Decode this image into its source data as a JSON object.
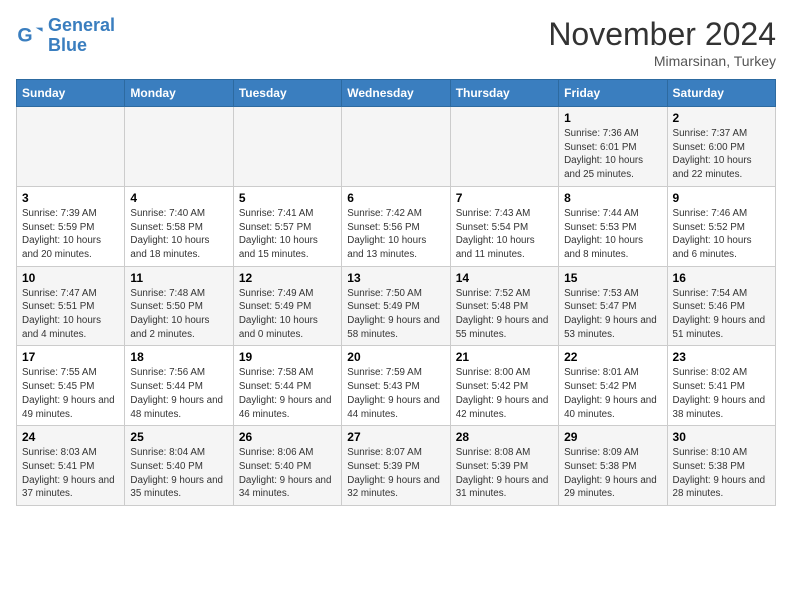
{
  "logo": {
    "line1": "General",
    "line2": "Blue"
  },
  "title": "November 2024",
  "location": "Mimarsinan, Turkey",
  "weekdays": [
    "Sunday",
    "Monday",
    "Tuesday",
    "Wednesday",
    "Thursday",
    "Friday",
    "Saturday"
  ],
  "weeks": [
    [
      {
        "day": "",
        "info": ""
      },
      {
        "day": "",
        "info": ""
      },
      {
        "day": "",
        "info": ""
      },
      {
        "day": "",
        "info": ""
      },
      {
        "day": "",
        "info": ""
      },
      {
        "day": "1",
        "info": "Sunrise: 7:36 AM\nSunset: 6:01 PM\nDaylight: 10 hours and 25 minutes."
      },
      {
        "day": "2",
        "info": "Sunrise: 7:37 AM\nSunset: 6:00 PM\nDaylight: 10 hours and 22 minutes."
      }
    ],
    [
      {
        "day": "3",
        "info": "Sunrise: 7:39 AM\nSunset: 5:59 PM\nDaylight: 10 hours and 20 minutes."
      },
      {
        "day": "4",
        "info": "Sunrise: 7:40 AM\nSunset: 5:58 PM\nDaylight: 10 hours and 18 minutes."
      },
      {
        "day": "5",
        "info": "Sunrise: 7:41 AM\nSunset: 5:57 PM\nDaylight: 10 hours and 15 minutes."
      },
      {
        "day": "6",
        "info": "Sunrise: 7:42 AM\nSunset: 5:56 PM\nDaylight: 10 hours and 13 minutes."
      },
      {
        "day": "7",
        "info": "Sunrise: 7:43 AM\nSunset: 5:54 PM\nDaylight: 10 hours and 11 minutes."
      },
      {
        "day": "8",
        "info": "Sunrise: 7:44 AM\nSunset: 5:53 PM\nDaylight: 10 hours and 8 minutes."
      },
      {
        "day": "9",
        "info": "Sunrise: 7:46 AM\nSunset: 5:52 PM\nDaylight: 10 hours and 6 minutes."
      }
    ],
    [
      {
        "day": "10",
        "info": "Sunrise: 7:47 AM\nSunset: 5:51 PM\nDaylight: 10 hours and 4 minutes."
      },
      {
        "day": "11",
        "info": "Sunrise: 7:48 AM\nSunset: 5:50 PM\nDaylight: 10 hours and 2 minutes."
      },
      {
        "day": "12",
        "info": "Sunrise: 7:49 AM\nSunset: 5:49 PM\nDaylight: 10 hours and 0 minutes."
      },
      {
        "day": "13",
        "info": "Sunrise: 7:50 AM\nSunset: 5:49 PM\nDaylight: 9 hours and 58 minutes."
      },
      {
        "day": "14",
        "info": "Sunrise: 7:52 AM\nSunset: 5:48 PM\nDaylight: 9 hours and 55 minutes."
      },
      {
        "day": "15",
        "info": "Sunrise: 7:53 AM\nSunset: 5:47 PM\nDaylight: 9 hours and 53 minutes."
      },
      {
        "day": "16",
        "info": "Sunrise: 7:54 AM\nSunset: 5:46 PM\nDaylight: 9 hours and 51 minutes."
      }
    ],
    [
      {
        "day": "17",
        "info": "Sunrise: 7:55 AM\nSunset: 5:45 PM\nDaylight: 9 hours and 49 minutes."
      },
      {
        "day": "18",
        "info": "Sunrise: 7:56 AM\nSunset: 5:44 PM\nDaylight: 9 hours and 48 minutes."
      },
      {
        "day": "19",
        "info": "Sunrise: 7:58 AM\nSunset: 5:44 PM\nDaylight: 9 hours and 46 minutes."
      },
      {
        "day": "20",
        "info": "Sunrise: 7:59 AM\nSunset: 5:43 PM\nDaylight: 9 hours and 44 minutes."
      },
      {
        "day": "21",
        "info": "Sunrise: 8:00 AM\nSunset: 5:42 PM\nDaylight: 9 hours and 42 minutes."
      },
      {
        "day": "22",
        "info": "Sunrise: 8:01 AM\nSunset: 5:42 PM\nDaylight: 9 hours and 40 minutes."
      },
      {
        "day": "23",
        "info": "Sunrise: 8:02 AM\nSunset: 5:41 PM\nDaylight: 9 hours and 38 minutes."
      }
    ],
    [
      {
        "day": "24",
        "info": "Sunrise: 8:03 AM\nSunset: 5:41 PM\nDaylight: 9 hours and 37 minutes."
      },
      {
        "day": "25",
        "info": "Sunrise: 8:04 AM\nSunset: 5:40 PM\nDaylight: 9 hours and 35 minutes."
      },
      {
        "day": "26",
        "info": "Sunrise: 8:06 AM\nSunset: 5:40 PM\nDaylight: 9 hours and 34 minutes."
      },
      {
        "day": "27",
        "info": "Sunrise: 8:07 AM\nSunset: 5:39 PM\nDaylight: 9 hours and 32 minutes."
      },
      {
        "day": "28",
        "info": "Sunrise: 8:08 AM\nSunset: 5:39 PM\nDaylight: 9 hours and 31 minutes."
      },
      {
        "day": "29",
        "info": "Sunrise: 8:09 AM\nSunset: 5:38 PM\nDaylight: 9 hours and 29 minutes."
      },
      {
        "day": "30",
        "info": "Sunrise: 8:10 AM\nSunset: 5:38 PM\nDaylight: 9 hours and 28 minutes."
      }
    ]
  ]
}
